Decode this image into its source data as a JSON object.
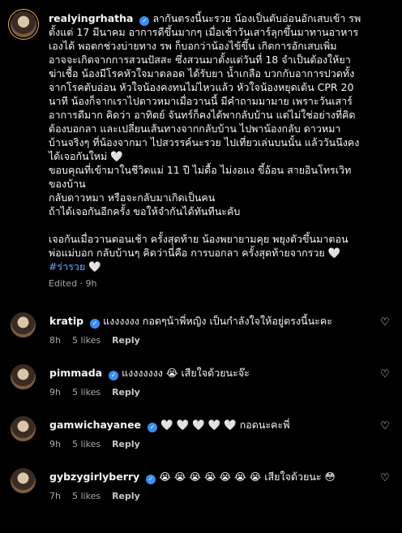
{
  "post": {
    "username": "realyingrhatha",
    "lines": [
      "ลากันตรงนี้นะรวย น้องเป็นตับอ่อนอักเสบเข้า รพ",
      "ตั้งแต่ 17 มีนาคม อาการดีขึ้นมากๆ เมื่อเช้าวันเสาร์ลุกขึ้นมาทานอาหาร",
      "เองได้ พอตกช่วงบ่ายทาง รพ ก็บอกว่าน้องไข้ขึ้น เกิดการอักเสบเพิ่ม",
      "อาจจะเกิดจากการสวนปัสสะ ซึ่งสวนมาตั้งแต่วันที่ 18 จำเป็นต้องให้ยา",
      "ฆ่าเชื้อ น้องมีโรคหัวใจมาตลอด ได้รับยา น้ำเกลือ บวกกับอาการปวดทั้ง",
      "จากโรคตับอ่อน หัวใจน้องคงทนไม่ไหวแล้ว หัวใจน้องหยุดเต้น CPR 20",
      "นาที น้องก็จากเราไปตาวหมาเมื่อวานนี้ มีคำถามมามาย เพราะวันเสาร์",
      "อาการดีมาก คิดว่า อาทิตย์ จันทร์ก็คงได้พากลับบ้าน แต่ไม่ใช่อย่างที่คิด",
      "ต้องบอกลา และเปลี่ยนเส้นทางจากกลับบ้าน ไปพาน้องกลับ ดาวหมา",
      "บ้านจริงๆ ที่น้องจากมา ไปสวรรค์นะรวย ไปเที่ยวเล่นบนนั้น แล้ววันนึงคง",
      "ได้เจอกันใหม่ 🤍",
      "ขอบคุณที่เข้ามาในชีวิตแม่ 11 ปี ไม่ดื้อ ไม่งอแง ขี้อ้อน สายอินโทรเวิท",
      "ของบ้าน",
      "กลับดาวหมา หรือจะกลับมาเกิดเป็นคน",
      "ถ้าได้เจอกันอีกครั้ง ขอให้จำกันได้ทันทีนะคับ",
      "",
      "เจอกันเมื่อวานตอนเช้า ครั้งสุดท้าย น้องพยายามคุย พยุงตัวขึ้นมาตอน",
      "พ่อแม่บอก กลับบ้านๆ คิดว่านี่คือ การบอกลา ครั้งสุดท้ายจากรวย 🤍"
    ],
    "hashtag": "#ร่ารวย",
    "hashtag_suffix": " 🤍",
    "edited": "Edited · 9h"
  },
  "comments": [
    {
      "username": "kratip",
      "text": "แงงงงงง กอดๆน้าพี่หญิง เป็นกำลังใจให้อยู่ตรงนี้นะคะ",
      "time": "8h",
      "likes": "5 likes",
      "reply": "Reply"
    },
    {
      "username": "pimmada",
      "text": "แงงงงงงง 😭 เสียใจด้วยนะจ๊ะ",
      "time": "9h",
      "likes": "5 likes",
      "reply": "Reply"
    },
    {
      "username": "gamwichayanee",
      "text": "🤍 🤍 🤍 🤍 🤍 กอดนะคะพี่",
      "time": "9h",
      "likes": "5 likes",
      "reply": "Reply"
    },
    {
      "username": "gybzygirlyberry",
      "text": "😭 😭 😭 😭 😭 😭 😭 เสียใจด้วยนะ 😳",
      "time": "7h",
      "likes": "5 likes",
      "reply": "Reply"
    }
  ],
  "icons": {
    "like": "heart-outline-icon",
    "verified": "verified-badge-icon"
  },
  "colors": {
    "background": "#000000",
    "verified": "#3a8df5",
    "hashtag": "#6ea8ff"
  }
}
